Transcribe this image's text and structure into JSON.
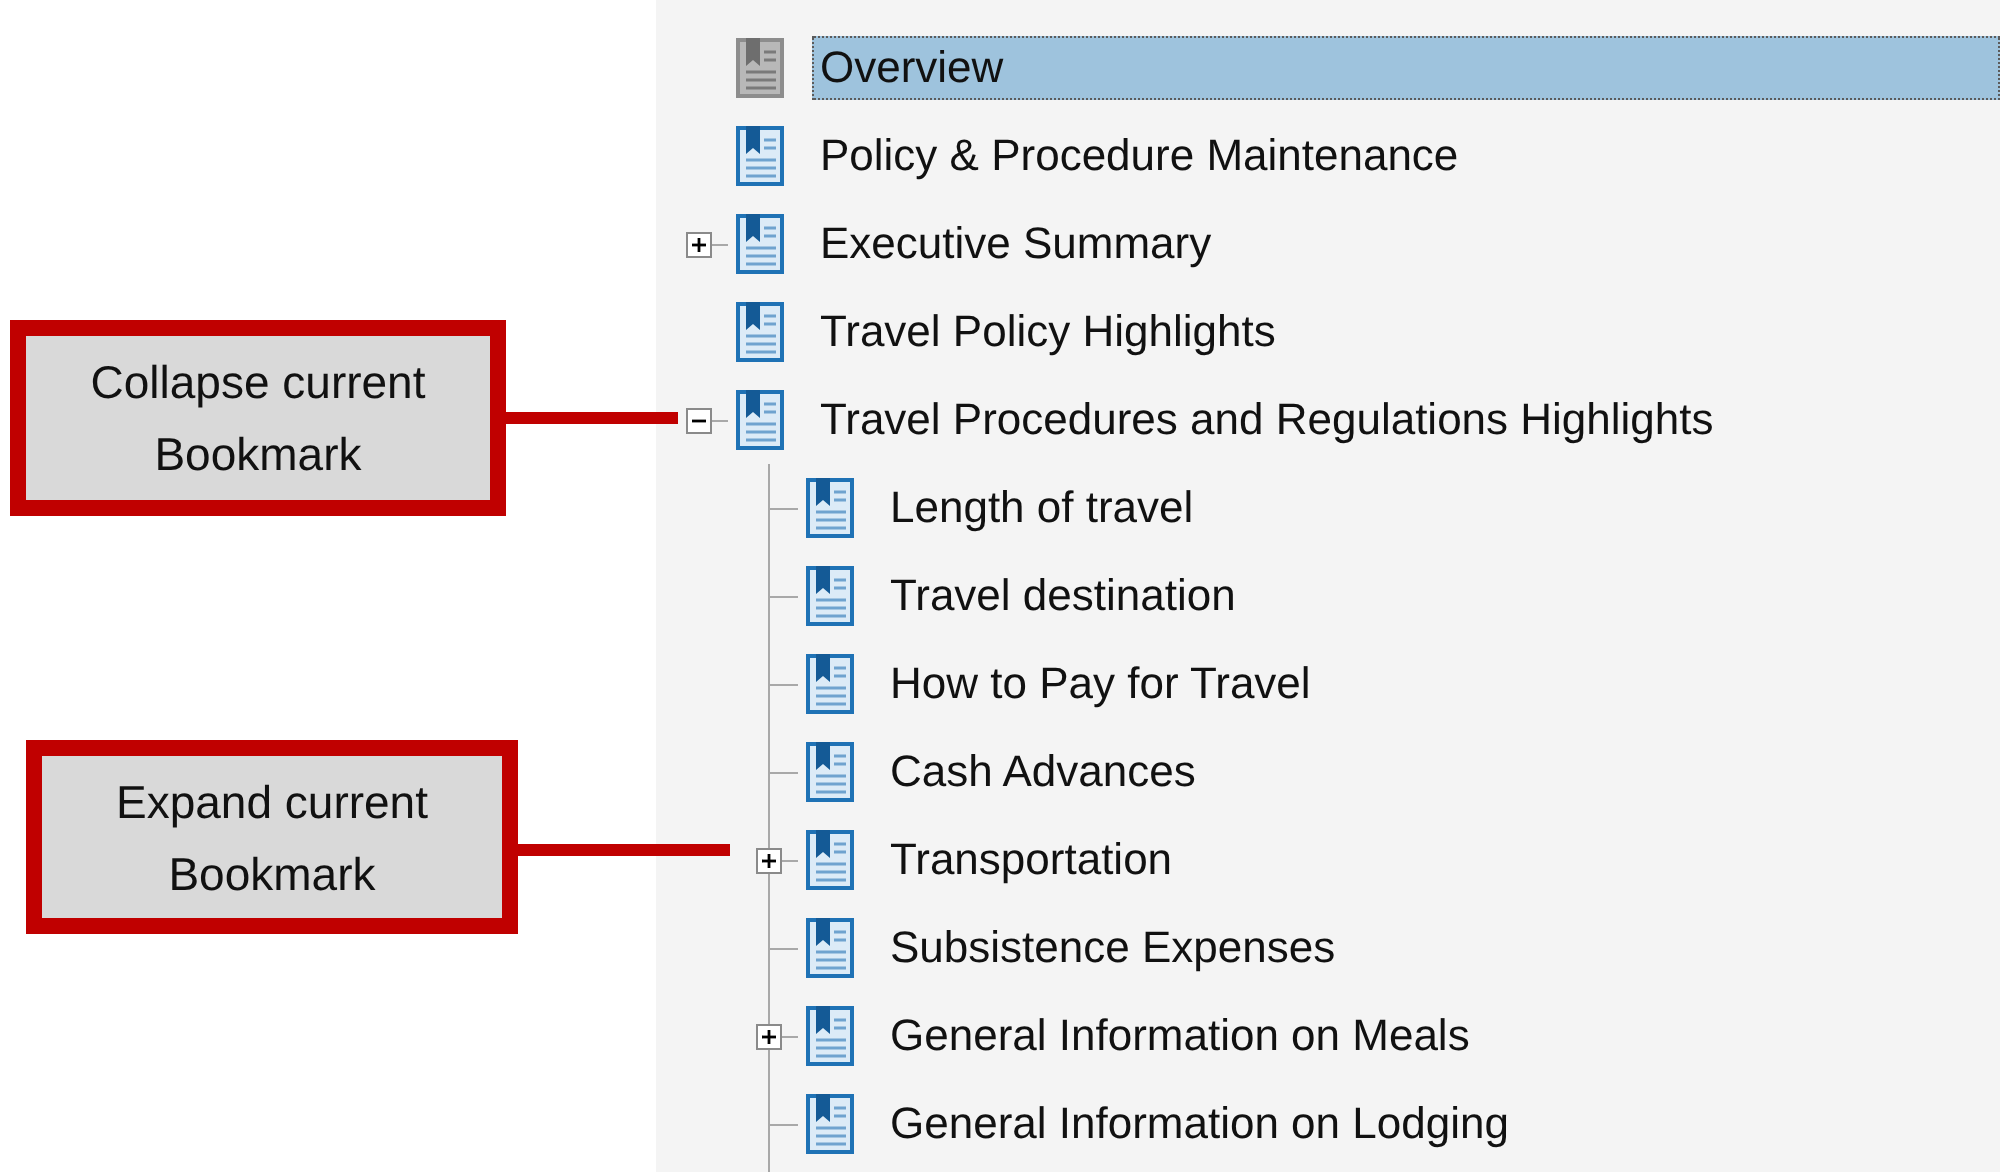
{
  "bookmarks": [
    {
      "label": "Overview",
      "selected": true
    },
    {
      "label": "Policy & Procedure Maintenance",
      "selected": false
    },
    {
      "label": "Executive Summary",
      "selected": false,
      "expanded": false
    },
    {
      "label": "Travel Policy Highlights",
      "selected": false
    },
    {
      "label": "Travel Procedures and Regulations Highlights",
      "selected": false,
      "expanded": true,
      "children": [
        {
          "label": "Length of travel",
          "selected": false
        },
        {
          "label": "Travel destination",
          "selected": false
        },
        {
          "label": "How to Pay for Travel",
          "selected": false
        },
        {
          "label": "Cash Advances",
          "selected": false
        },
        {
          "label": "Transportation",
          "selected": false,
          "expanded": false
        },
        {
          "label": "Subsistence Expenses",
          "selected": false
        },
        {
          "label": "General Information on Meals",
          "selected": false,
          "expanded": false
        },
        {
          "label": "General Information on Lodging",
          "selected": false
        }
      ]
    }
  ],
  "callouts": [
    {
      "text": "Collapse current Bookmark"
    },
    {
      "text": "Expand current Bookmark"
    }
  ]
}
